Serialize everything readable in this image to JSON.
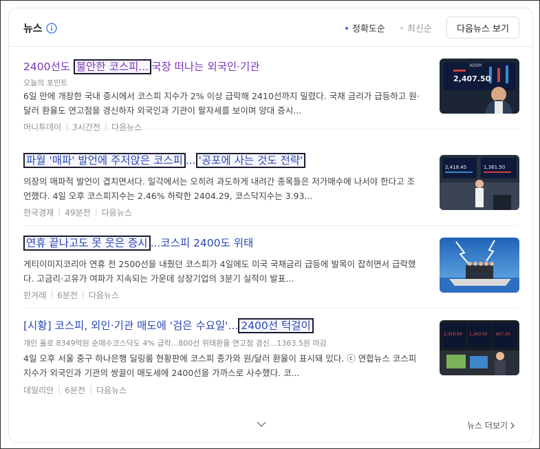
{
  "header": {
    "title": "뉴스",
    "info_icon": "info-circle-icon",
    "sort_options": [
      "정확도순",
      "최신순"
    ],
    "more_button": "다음뉴스 보기"
  },
  "colors": {
    "accent": "#3c6be8",
    "link": "#2948b3",
    "visited_link": "#7a35b6"
  },
  "articles": [
    {
      "title_pre": "2400선도 ",
      "title_hl": "불안한 코스피...",
      "title_post": "국장 떠나는 외국인·기관",
      "subtitle": "오늘의 포인트",
      "desc": "6일 만에 개장한 국내 증시에서 코스피 지수가 2% 이상 급락해 2410선까지 밀렸다. 국채 금리가 급등하고 원·달러 환율도 연고점을 경신하자 외국인과 기관이 팔자세를 보이며 양대 증시...",
      "source": "머니투데이",
      "time": "3시간전",
      "via": "다음뉴스",
      "thumb_text": "2,407.50",
      "thumb_sub": "KOSPI"
    },
    {
      "title_hl": "파월 '매파' 발언에 주저앉은 코스피",
      "title_mid": "...",
      "title_hl2": "'공포에 사는 것도 전략'",
      "desc": "의장의 매파적 발언이 겹치면서다. 일각에서는 오히려 과도하게 내려간 종목들은 저가매수에 나서야 한다고 조언했다. 4일 오후 코스피지수는 2.46% 하락한 2404.29, 코스닥지수는 3.93...",
      "source": "한국경제",
      "time": "49분전",
      "via": "다음뉴스",
      "thumb_text": "2,418.45",
      "thumb_text2": "1,361.50"
    },
    {
      "title_hl": "연휴 끝나고도 못 웃은 증시",
      "title_post": "...코스피 2400도 위태",
      "desc": "게티이미지코리아 연휴 전 2500선을 내줬던 코스피가 4일에도 미국 국채금리 급등에 발목이 잡히면서 급락했다. 고금리·고유가 여파가 지속되는 가운데 상장기업의 3분기 실적이 발표...",
      "source": "한겨레",
      "time": "6분전",
      "via": "다음뉴스"
    },
    {
      "title_pre": "[시황] 코스피, 외인·기관 매도에 '검은 수요일'...",
      "title_hl": "2400선 턱걸이",
      "subtitle": "개인 홀로 8349억원 순매수코스닥도 4% 급락...800선 위태환율 연고점 경신...1363.5원 마감",
      "desc": "4일 오후 서울 중구 하나은행 딜링룸 현황판에 코스피 종가와 원/달러 환율이 표시돼 있다. ⓒ 연합뉴스 코스피 지수가 외국인과 기관의 쌍끌이 매도세에 2400선을 가까스로 사수했다. 코...",
      "source": "데일리안",
      "time": "6분전",
      "via": "다음뉴스",
      "thumb_text": "2,418.69",
      "thumb_text2": "807.40",
      "thumb_text3": "1,363.50"
    }
  ],
  "footer": {
    "expand_icon": "chevron-down-icon",
    "news_more": "뉴스 더보기",
    "news_more_icon": "chevron-right-icon"
  }
}
